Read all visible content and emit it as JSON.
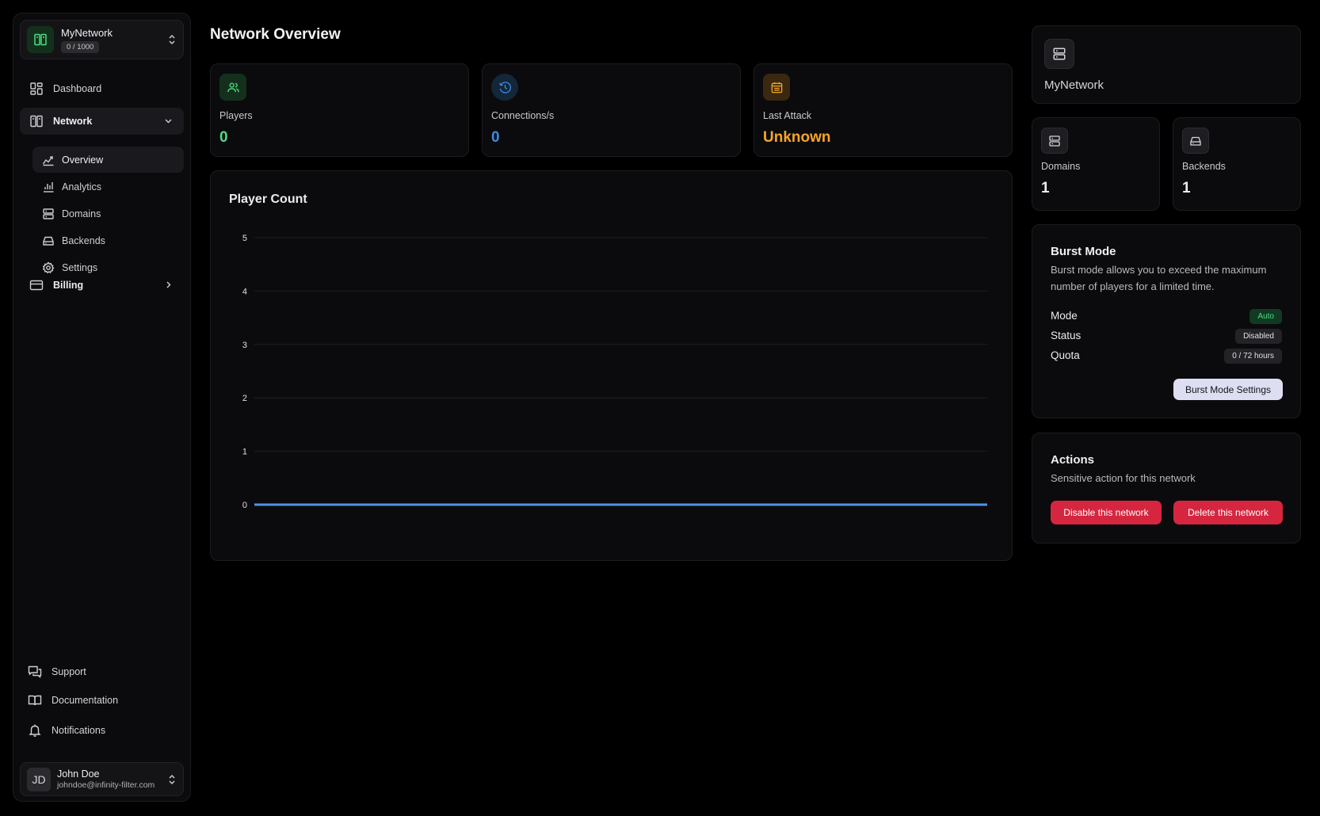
{
  "sidebar": {
    "org": {
      "name": "MyNetwork",
      "usage": "0 / 1000"
    },
    "dashboard": {
      "label": "Dashboard"
    },
    "network": {
      "label": "Network",
      "items": [
        {
          "label": "Overview"
        },
        {
          "label": "Analytics"
        },
        {
          "label": "Domains"
        },
        {
          "label": "Backends"
        },
        {
          "label": "Settings"
        }
      ]
    },
    "billing": {
      "label": "Billing"
    },
    "bottom": {
      "support": "Support",
      "documentation": "Documentation",
      "notifications": "Notifications"
    },
    "user": {
      "initials": "JD",
      "name": "John Doe",
      "email": "johndoe@infinity-filter.com"
    }
  },
  "main": {
    "title": "Network Overview",
    "stats": {
      "players": {
        "label": "Players",
        "value": "0"
      },
      "connections": {
        "label": "Connections/s",
        "value": "0"
      },
      "last_attack": {
        "label": "Last Attack",
        "value": "Unknown"
      }
    },
    "chart": {
      "title": "Player Count"
    }
  },
  "chart_data": {
    "type": "line",
    "title": "Player Count",
    "xlabel": "",
    "ylabel": "",
    "ylim": [
      0,
      5
    ],
    "y_ticks": [
      "0",
      "1",
      "2",
      "3",
      "4",
      "5"
    ],
    "grid": true,
    "series": [
      {
        "values": [
          0,
          0
        ],
        "color": "#4f93e8"
      }
    ]
  },
  "right": {
    "network": {
      "name": "MyNetwork"
    },
    "domains": {
      "label": "Domains",
      "value": "1"
    },
    "backends": {
      "label": "Backends",
      "value": "1"
    },
    "burst": {
      "title": "Burst Mode",
      "description": "Burst mode allows you to exceed the maximum number of players for a limited time.",
      "mode_label": "Mode",
      "mode_value": "Auto",
      "status_label": "Status",
      "status_value": "Disabled",
      "quota_label": "Quota",
      "quota_value": "0 / 72 hours",
      "settings_button": "Burst Mode Settings"
    },
    "actions": {
      "title": "Actions",
      "description": "Sensitive action for this network",
      "disable_button": "Disable this network",
      "delete_button": "Delete this network"
    }
  },
  "colors": {
    "accent_green": "#4ade80",
    "accent_blue": "#3b8be0",
    "accent_orange": "#f5a623",
    "danger": "#d6263f",
    "background": "#000000"
  }
}
